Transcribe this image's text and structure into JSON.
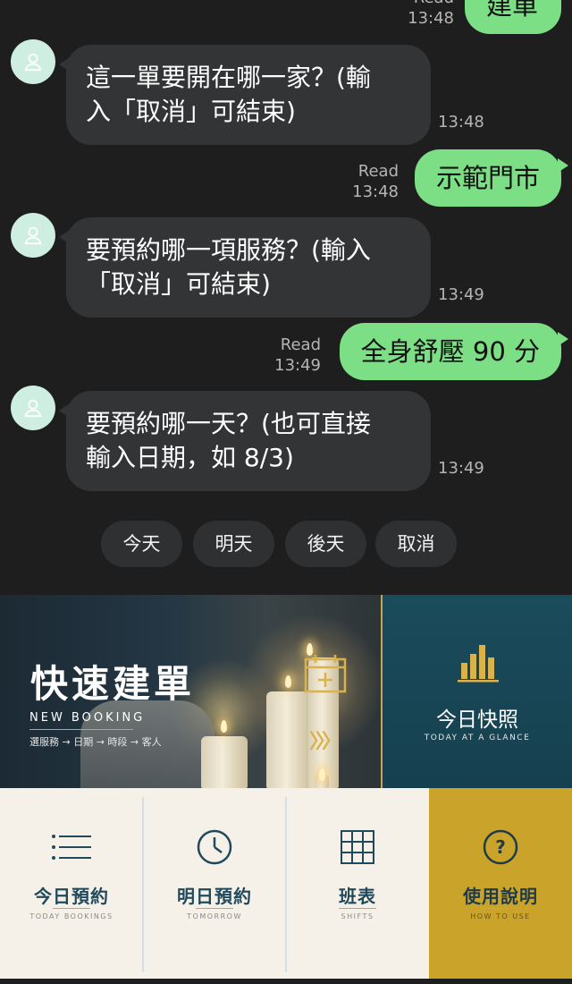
{
  "chat": {
    "top_out": {
      "meta_read": "Read",
      "time": "13:48",
      "text": "建單"
    },
    "messages": [
      {
        "text_line1": "這一單要開在哪一家？(輸",
        "text_line2": "入「取消」可結束)",
        "time": "13:48"
      },
      {
        "text_line1": "要預約哪一項服務？(輸入",
        "text_line2": "「取消」可結束)",
        "time": "13:49"
      },
      {
        "text_line1": "要預約哪一天？(也可直接",
        "text_line2": "輸入日期，如 8/3)",
        "time": "13:49"
      }
    ],
    "replies": [
      {
        "read": "Read",
        "time": "13:48",
        "text": "示範門市"
      },
      {
        "read": "Read",
        "time": "13:49",
        "text": "全身舒壓 90 分"
      }
    ],
    "quick_replies": [
      "今天",
      "明天",
      "後天",
      "取消"
    ]
  },
  "menu": {
    "new_booking": {
      "title": "快速建單",
      "subtitle": "NEW BOOKING",
      "steps": "選服務 → 日期 → 時段 → 客人"
    },
    "glance": {
      "title": "今日快照",
      "subtitle": "TODAY AT A GLANCE"
    },
    "tiles": [
      {
        "label": "今日預約",
        "sub": "TODAY BOOKINGS",
        "icon": "list-icon"
      },
      {
        "label": "明日預約",
        "sub": "TOMORROW",
        "icon": "clock-icon"
      },
      {
        "label": "班表",
        "sub": "SHIFTS",
        "icon": "grid-icon"
      },
      {
        "label": "使用說明",
        "sub": "HOW TO USE",
        "icon": "question-icon"
      }
    ],
    "colors": {
      "gold": "#c9a32a",
      "teal": "#16404f",
      "cream": "#f6f1e8",
      "bubble_out": "#7cde85",
      "bubble_in": "#333436"
    }
  }
}
